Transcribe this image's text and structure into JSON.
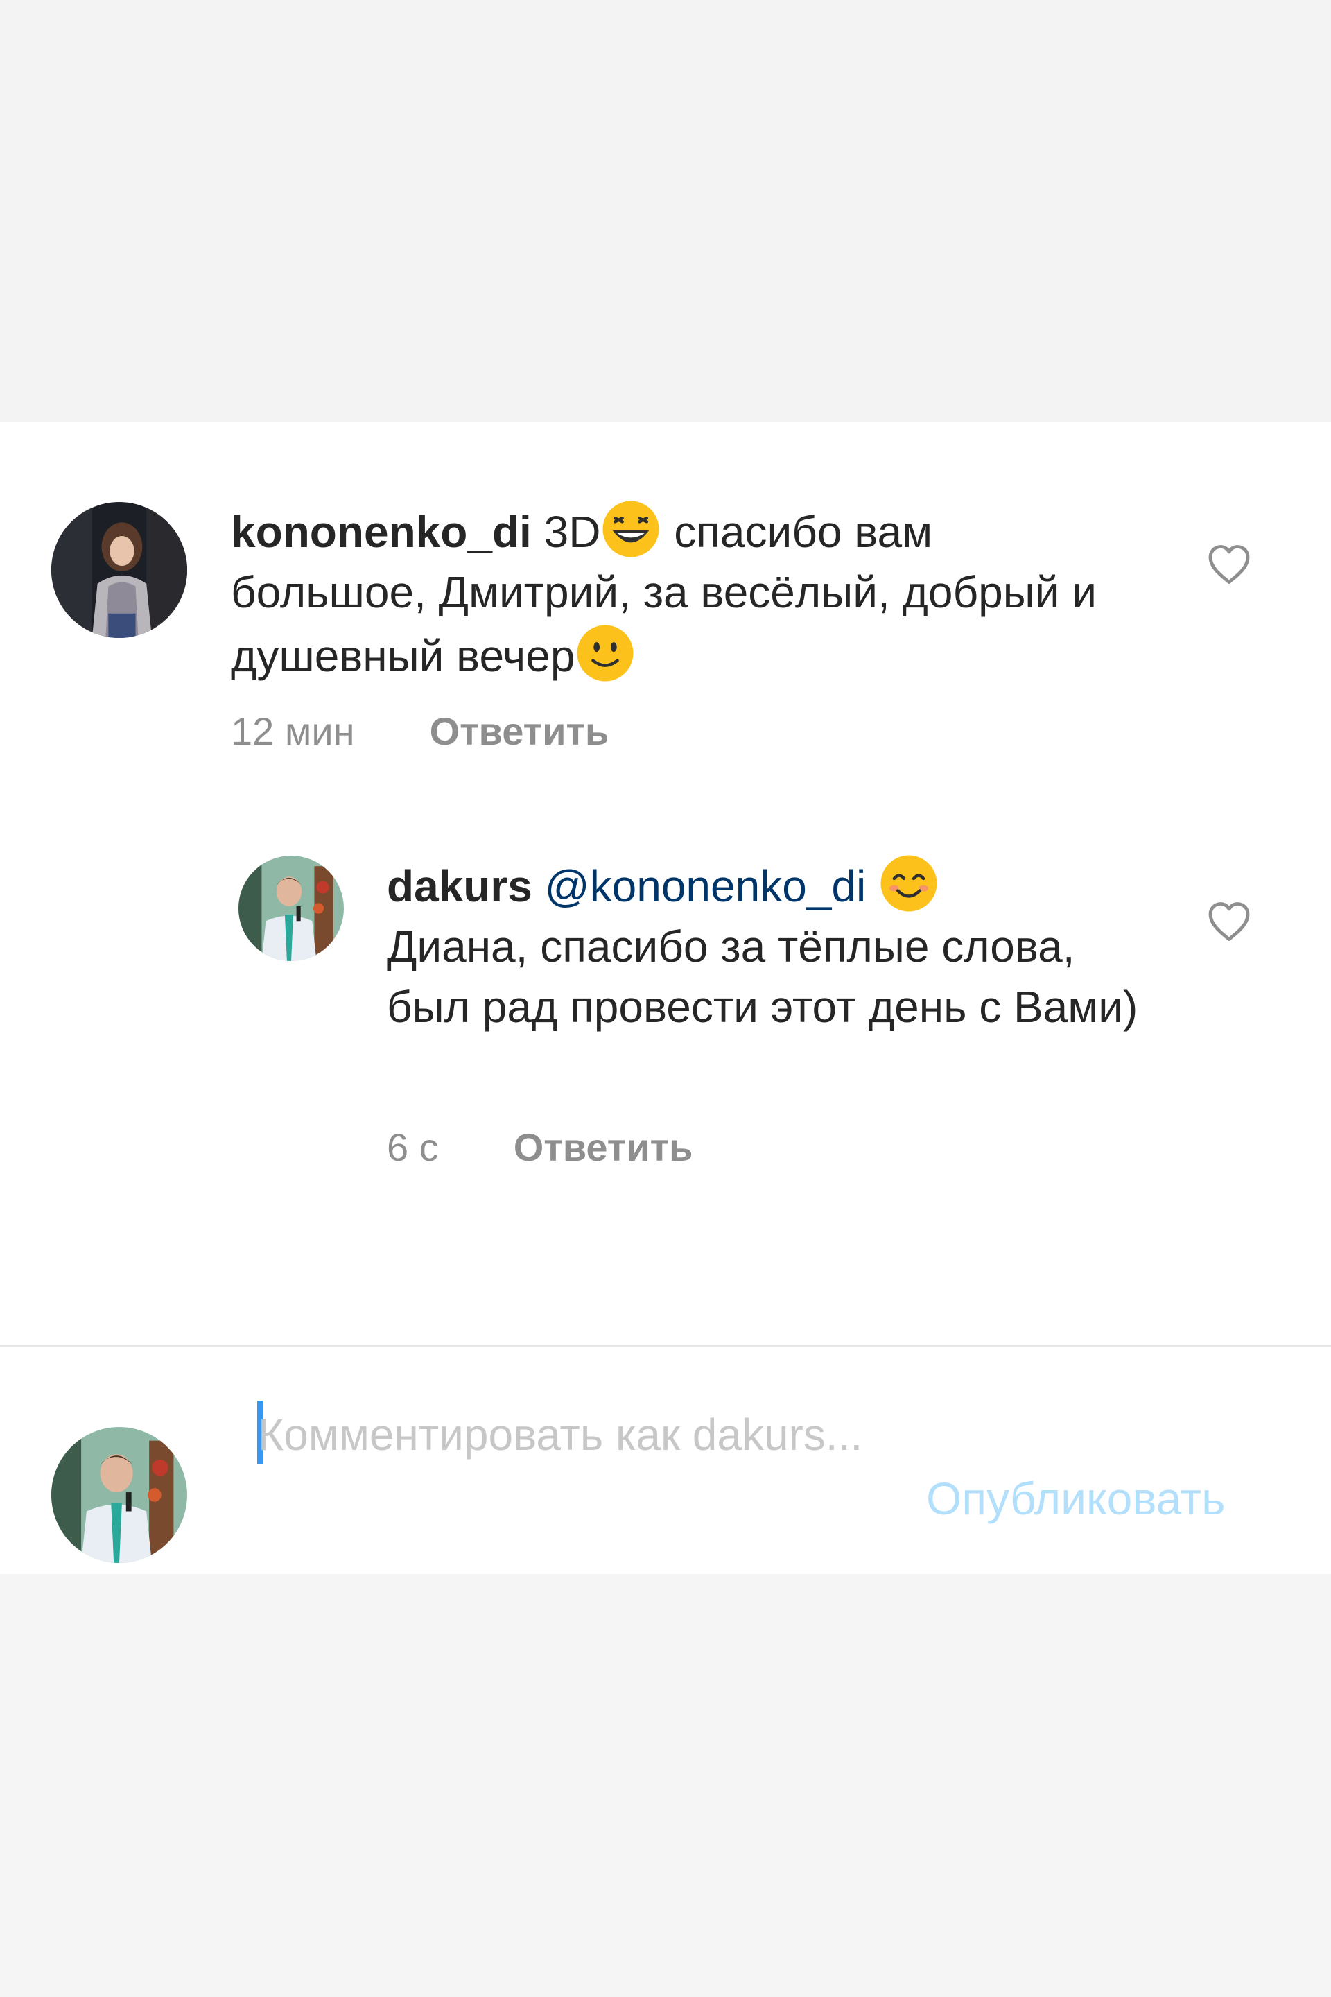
{
  "comments": {
    "main": {
      "username": "kononenko_di",
      "text_before_emoji": "3D",
      "emoji1": "grinning-squinting-face",
      "text_mid": " спасибо вам большое, Дмитрий, за весёлый, добрый и душевный вечер",
      "emoji2": "slightly-smiling-face",
      "time": "12 мин",
      "reply_label": "Ответить",
      "like_icon": "heart-outline-icon"
    },
    "reply": {
      "username": "dakurs",
      "mention": "@kononenko_di",
      "emoji": "smiling-face-with-smiling-eyes",
      "text": "Диана, спасибо за тёплые слова, был рад провести этот день с Вами)",
      "time": "6 с",
      "reply_label": "Ответить",
      "like_icon": "heart-outline-icon"
    }
  },
  "composer": {
    "placeholder": "Комментировать как dakurs...",
    "publish_label": "Опубликовать"
  },
  "colors": {
    "background_panel": "#ffffff",
    "background_outer": "#f3f3f3",
    "text_primary": "#262626",
    "text_secondary": "#8e8e8e",
    "mention": "#003569",
    "publish_disabled": "#b2dffc",
    "caret": "#3897f0"
  }
}
